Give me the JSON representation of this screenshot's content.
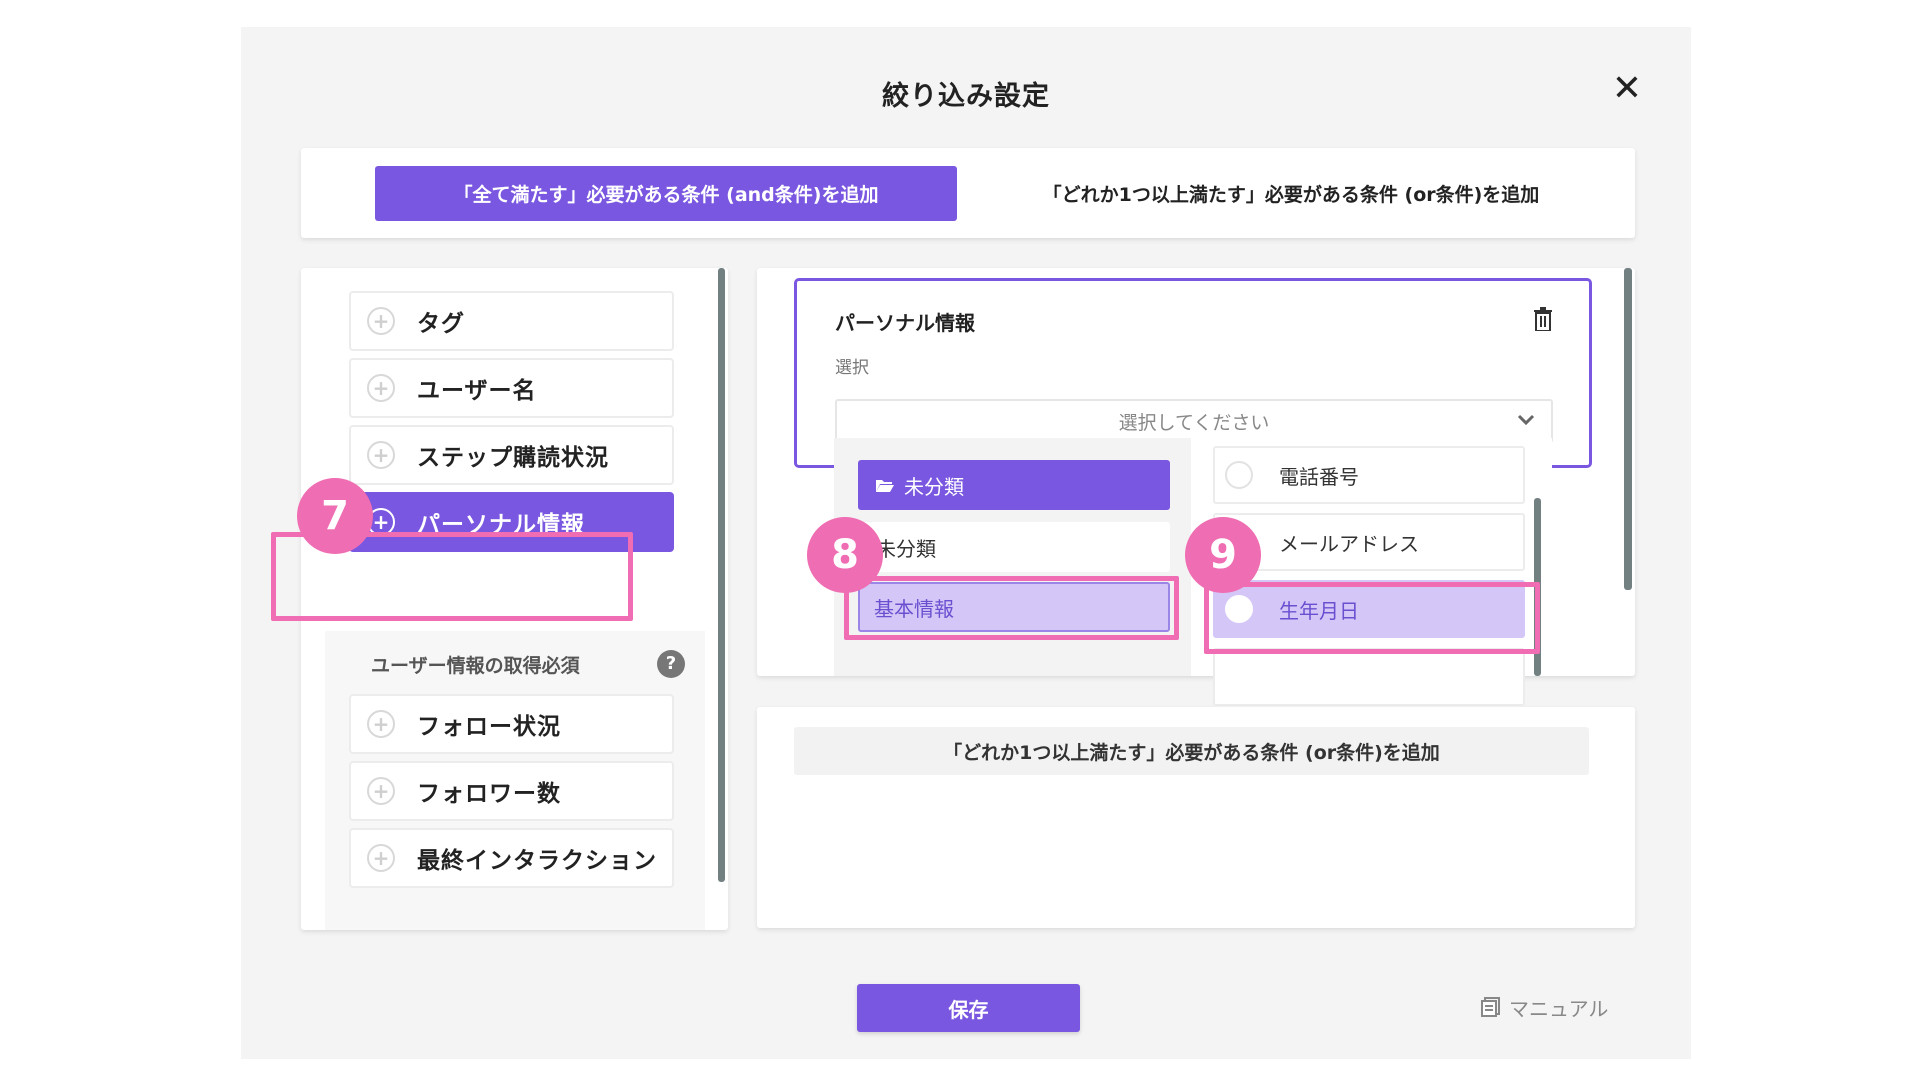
{
  "modal": {
    "title": "絞り込み設定",
    "close_icon": "close-icon"
  },
  "tabs": {
    "and_label": "「全て満たす」必要がある条件 (and条件)を追加",
    "or_label": "「どれか1つ以上満たす」必要がある条件 (or条件)を追加"
  },
  "sidebar": {
    "items": [
      {
        "label": "タグ",
        "icon": "plus-circle-icon"
      },
      {
        "label": "ユーザー名",
        "icon": "plus-circle-icon"
      },
      {
        "label": "ステップ購読状況",
        "icon": "plus-circle-icon"
      },
      {
        "label": "パーソナル情報",
        "icon": "plus-circle-icon",
        "active": true
      }
    ],
    "section_label": "ユーザー情報の取得必須",
    "help_icon": "?",
    "section_items": [
      {
        "label": "フォロー状況",
        "icon": "plus-circle-icon"
      },
      {
        "label": "フォロワー数",
        "icon": "plus-circle-icon"
      },
      {
        "label": "最終インタラクション",
        "icon": "plus-circle-icon"
      }
    ]
  },
  "condition": {
    "title": "パーソナル情報",
    "sub_label": "選択",
    "select_placeholder": "選択してください",
    "trash_icon": "trash-icon"
  },
  "dropdown": {
    "folders": [
      {
        "label": "未分類",
        "icon": "folder-open-icon",
        "active": true
      },
      {
        "label": "未分類"
      },
      {
        "label": "基本情報",
        "selected": true
      }
    ],
    "options": [
      {
        "label": "電話番号"
      },
      {
        "label": "メールアドレス"
      },
      {
        "label": "生年月日",
        "selected": true
      }
    ]
  },
  "annotations": {
    "badge_7": "7",
    "badge_8": "8",
    "badge_9": "9",
    "color": "#ef6db2"
  },
  "or_section": {
    "add_label": "「どれか1つ以上満たす」必要がある条件 (or条件)を追加"
  },
  "footer": {
    "save_label": "保存",
    "manual_label": "マニュアル",
    "manual_icon": "manual-book-icon"
  },
  "colors": {
    "accent": "#7a57e0",
    "accent_light": "#d4c6f7",
    "highlight": "#f06db3"
  }
}
